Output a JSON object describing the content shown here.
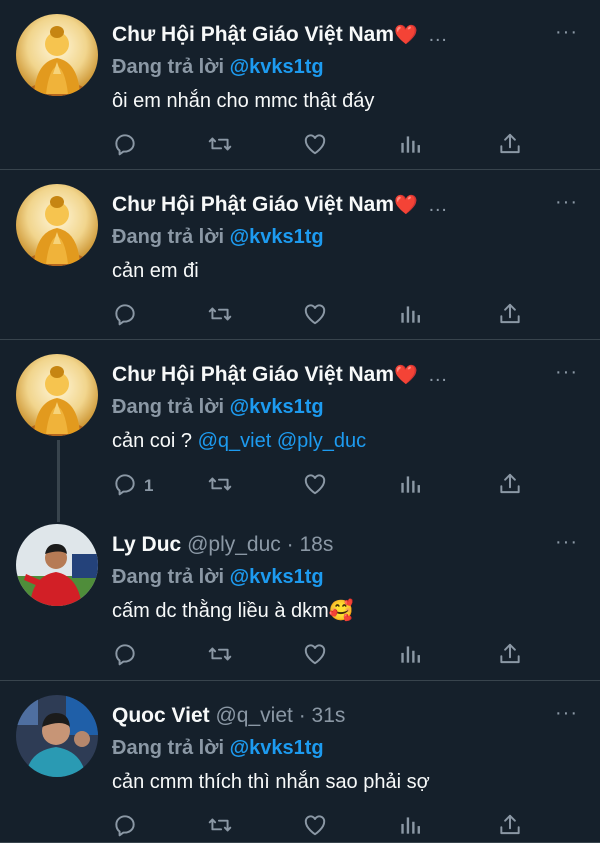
{
  "tweets": [
    {
      "name": "Chư Hội Phật Giáo Việt Nam",
      "heart": "❤️",
      "handle": "",
      "time": "",
      "caret": "…",
      "reply_prefix": "Đang trả lời",
      "reply_to": "@kvks1tg",
      "text_parts": [
        "ôi em nhắn cho mmc thật đáy"
      ],
      "reply_count": "",
      "avatar": "buddha"
    },
    {
      "name": "Chư Hội Phật Giáo Việt Nam",
      "heart": "❤️",
      "handle": "",
      "time": "",
      "caret": "…",
      "reply_prefix": "Đang trả lời",
      "reply_to": "@kvks1tg",
      "text_parts": [
        "cản em đi"
      ],
      "reply_count": "",
      "avatar": "buddha"
    },
    {
      "name": "Chư Hội Phật Giáo Việt Nam",
      "heart": "❤️",
      "handle": "",
      "time": "",
      "caret": "…",
      "reply_prefix": "Đang trả lời",
      "reply_to": "@kvks1tg",
      "text_parts": [
        "cản coi ? ",
        "@q_viet",
        " ",
        "@ply_duc"
      ],
      "reply_count": "1",
      "avatar": "buddha"
    },
    {
      "name": "Ly Duc",
      "heart": "",
      "handle": "@ply_duc",
      "time": "18s",
      "caret": "",
      "reply_prefix": "Đang trả lời",
      "reply_to": "@kvks1tg",
      "text_parts": [
        "cấm dc thằng liều à dkm🥰"
      ],
      "reply_count": "",
      "avatar": "player-red"
    },
    {
      "name": "Quoc Viet",
      "heart": "",
      "handle": "@q_viet",
      "time": "31s",
      "caret": "",
      "reply_prefix": "Đang trả lời",
      "reply_to": "@kvks1tg",
      "text_parts": [
        "cản cmm thích thì nhắn sao phải sợ"
      ],
      "reply_count": "",
      "avatar": "player-blue"
    }
  ],
  "more_label": "···",
  "dot": "·",
  "icons": {
    "reply": "reply-icon",
    "retweet": "retweet-icon",
    "like": "like-icon",
    "stats": "stats-icon",
    "share": "share-icon"
  },
  "colors": {
    "background": "#15202b",
    "text": "#f7f9f9",
    "muted": "#8b98a5",
    "link": "#1d9bf0",
    "heart": "#e0245e",
    "divider": "#38444d"
  }
}
